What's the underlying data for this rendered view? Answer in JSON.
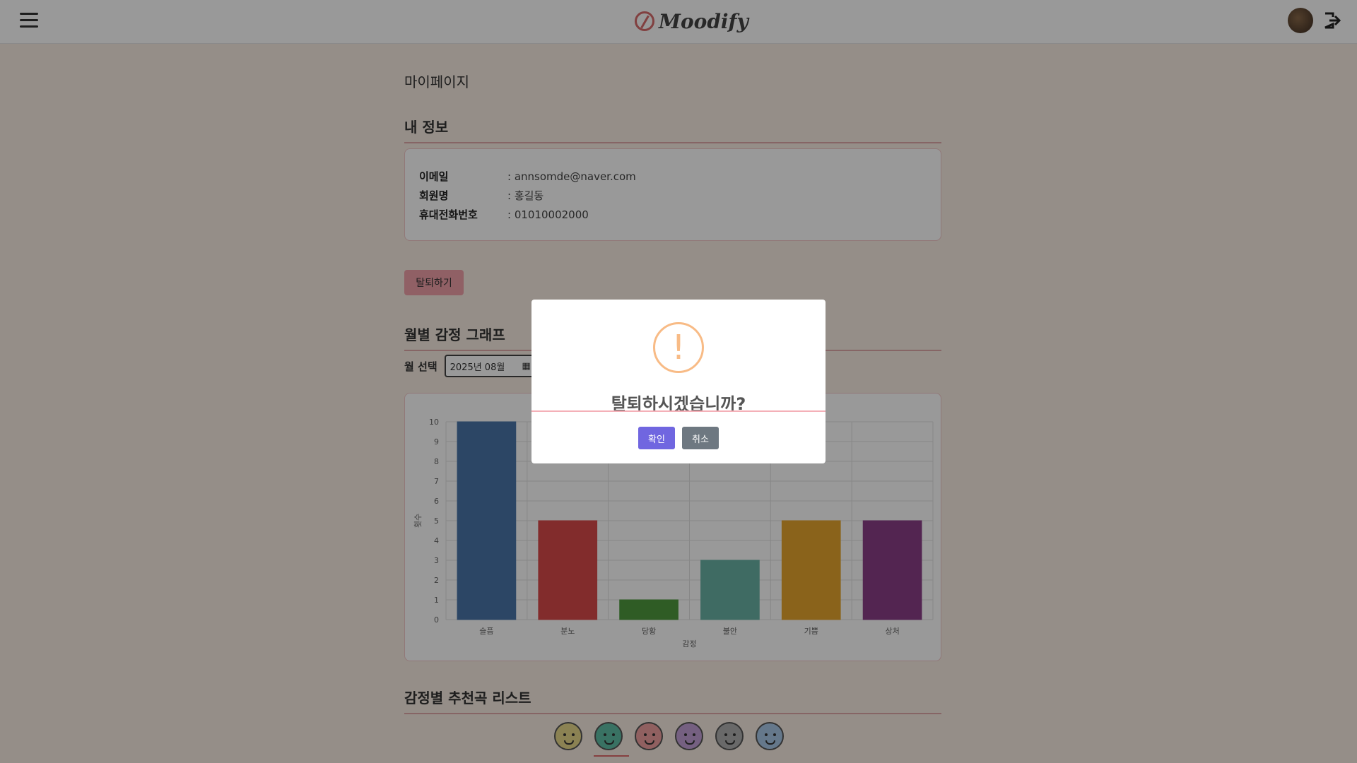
{
  "header": {
    "logo_text": "Moodify"
  },
  "page": {
    "title": "마이페이지"
  },
  "my_info": {
    "section_title": "내 정보",
    "rows": [
      {
        "label": "이메일",
        "value": ": annsomde@naver.com"
      },
      {
        "label": "회원명",
        "value": ": 홍길동"
      },
      {
        "label": "휴대전화번호",
        "value": ": 01010002000"
      }
    ]
  },
  "withdraw_button": "탈퇴하기",
  "monthly_graph": {
    "section_title": "월별 감정 그래프",
    "month_label": "월 선택",
    "month_value": "2025년 08월"
  },
  "recommend": {
    "section_title": "감정별 추천곡 리스트"
  },
  "chart_data": {
    "type": "bar",
    "categories": [
      "슬픔",
      "분노",
      "당황",
      "불안",
      "기쁨",
      "상처"
    ],
    "values": [
      10,
      5,
      1,
      3,
      5,
      5
    ],
    "colors": [
      "#4a76a8",
      "#d94a4a",
      "#4f9a3f",
      "#6ab3a6",
      "#e6a62e",
      "#8a3f87"
    ],
    "xlabel": "감정",
    "ylabel": "횟수",
    "ylim": [
      0,
      10
    ],
    "yticks": [
      "0",
      "1",
      "2",
      "3",
      "4",
      "5",
      "6",
      "7",
      "8",
      "9",
      "10"
    ],
    "grid": true
  },
  "emotion_icons": [
    "happy-face-icon",
    "surprised-face-icon",
    "angry-face-icon",
    "sad-face-icon",
    "hurt-face-icon",
    "crying-face-icon"
  ],
  "emotion_colors": [
    "#e8d98a",
    "#5fbfa6",
    "#f0a0a0",
    "#c4a0d8",
    "#b0b0b0",
    "#a8c8e8"
  ],
  "modal": {
    "title": "탈퇴하시겠습니까?",
    "icon": "!",
    "confirm_label": "확인",
    "cancel_label": "취소"
  }
}
